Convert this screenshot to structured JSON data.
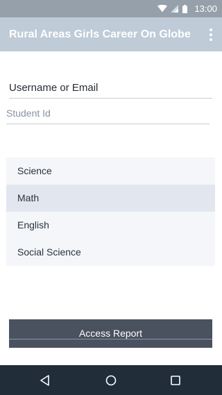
{
  "status_bar": {
    "time": "13:00",
    "icons": [
      "wifi-icon",
      "signal-icon",
      "battery-icon"
    ]
  },
  "app_bar": {
    "title": "Rural Areas Girls Career On Globe",
    "menu_icon": "more-vert-icon"
  },
  "form": {
    "username": {
      "placeholder": "Username or Email",
      "value": ""
    },
    "student_id": {
      "placeholder": "Student Id",
      "value": ""
    }
  },
  "subjects": {
    "items": [
      {
        "label": "Science"
      },
      {
        "label": "Math"
      },
      {
        "label": "English"
      },
      {
        "label": "Social Science"
      }
    ],
    "selected": "Math"
  },
  "action": {
    "label": "Access Report"
  },
  "nav_bar": {
    "icons": [
      "back-icon",
      "home-icon",
      "recents-icon"
    ]
  },
  "colors": {
    "status_bar": "#96a0aa",
    "app_bar": "#bfcbd7",
    "list_bg": "#f4f6f9",
    "list_selected": "#e2e7ef",
    "button": "#4a5260",
    "nav_bar": "#222d3a"
  }
}
